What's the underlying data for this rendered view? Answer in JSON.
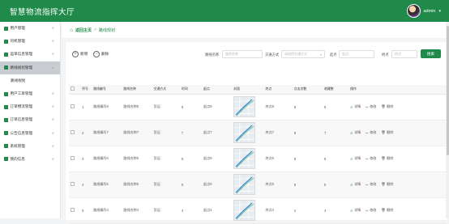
{
  "app": {
    "title": "智慧物流指挥大厅",
    "user_name": "admin",
    "user_caret": "▾"
  },
  "sidebar": {
    "items": [
      {
        "label": "用户管理",
        "icon": "user-icon",
        "color": "#1f8a4a"
      },
      {
        "label": "司机管理",
        "icon": "driver-icon",
        "color": "#1f8a4a"
      },
      {
        "label": "运单信息管理",
        "icon": "waybill-icon",
        "color": "#1f8a4a"
      },
      {
        "label": "路线规划管理",
        "icon": "route-icon",
        "color": "#1f8a4a",
        "active": true
      },
      {
        "label": "路线规划",
        "sub": true
      },
      {
        "label": "用户工单管理",
        "icon": "ticket-icon",
        "color": "#1f8a4a"
      },
      {
        "label": "订单物流管理",
        "icon": "order-logistics-icon",
        "color": "#1f8a4a"
      },
      {
        "label": "订单信息管理",
        "icon": "order-info-icon",
        "color": "#1f8a4a"
      },
      {
        "label": "公告信息管理",
        "icon": "notice-icon",
        "color": "#1f8a4a"
      },
      {
        "label": "系统管理",
        "icon": "system-icon",
        "color": "#1f8a4a"
      },
      {
        "label": "我的信息",
        "icon": "profile-icon",
        "color": "#1f8a4a"
      }
    ]
  },
  "breadcrumb": {
    "home": "返回主页",
    "separator": ">",
    "current": "路线规划"
  },
  "toolbar": {
    "add_label": "新增",
    "delete_label": "删除",
    "filters": [
      {
        "label": "路线名称",
        "placeholder": "路线名称"
      },
      {
        "label": "交通方式",
        "placeholder": "请选择交通方式"
      },
      {
        "label": "起点",
        "placeholder": "起点"
      },
      {
        "label": "终点",
        "placeholder": "终点"
      }
    ],
    "search_label": "搜索"
  },
  "table": {
    "columns": [
      "",
      "序号",
      "路线编号",
      "路线名称",
      "交通方式",
      "时间",
      "起点",
      "封面",
      "终点",
      "点击次数",
      "收藏数",
      "操作"
    ],
    "rows": [
      {
        "index": "1",
        "code": "路线编号8",
        "name": "路线名称8",
        "transport": "货运",
        "time": "8",
        "start": "起点8",
        "end": "终点8",
        "clicks": "9",
        "favorites": "8"
      },
      {
        "index": "2",
        "code": "路线编号7",
        "name": "路线名称7",
        "transport": "货运",
        "time": "7",
        "start": "起点7",
        "end": "终点7",
        "clicks": "9",
        "favorites": "7"
      },
      {
        "index": "3",
        "code": "路线编号6",
        "name": "路线名称6",
        "transport": "货运",
        "time": "6",
        "start": "起点6",
        "end": "终点6",
        "clicks": "6",
        "favorites": "6"
      },
      {
        "index": "4",
        "code": "路线编号5",
        "name": "路线名称5",
        "transport": "货运",
        "time": "5",
        "start": "起点5",
        "end": "终点5",
        "clicks": "5",
        "favorites": "5"
      },
      {
        "index": "5",
        "code": "路线编号4",
        "name": "路线名称4",
        "transport": "货运",
        "time": "4",
        "start": "起点4",
        "end": "终点4",
        "clicks": "4",
        "favorites": "4"
      }
    ],
    "actions": {
      "detail": "详情",
      "edit": "修改",
      "delete": "删除"
    }
  }
}
